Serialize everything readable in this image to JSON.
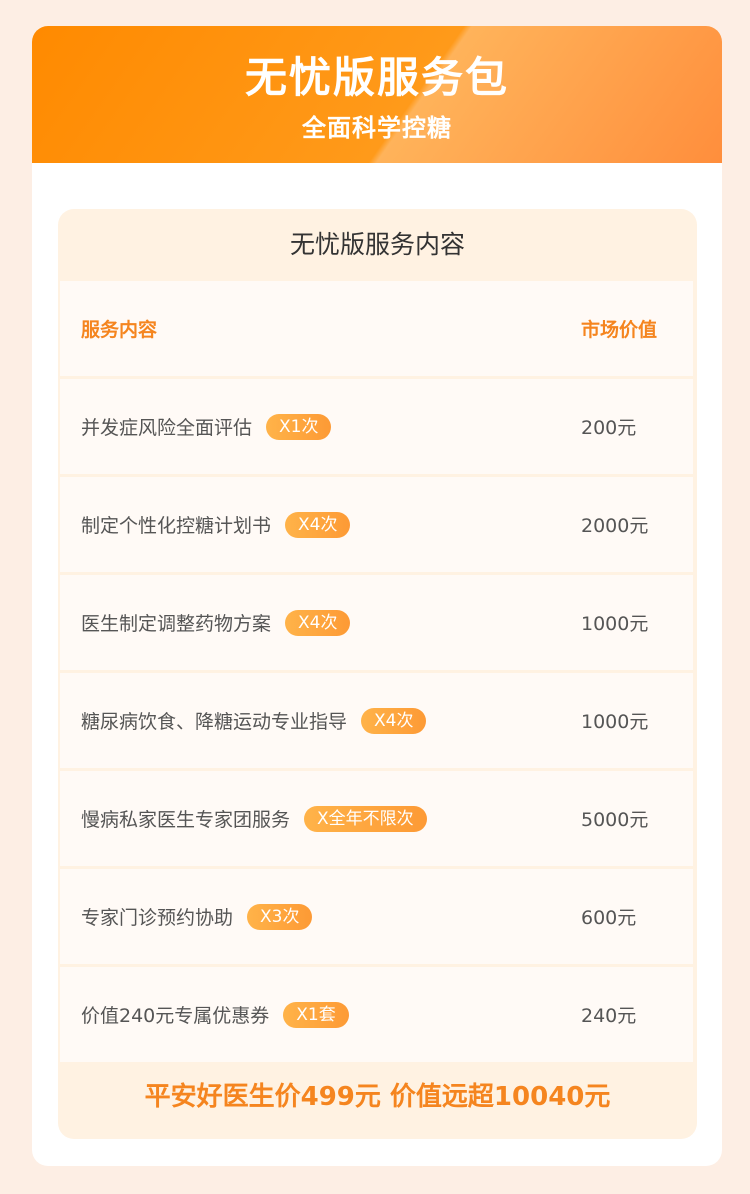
{
  "banner": {
    "title": "无忧版服务包",
    "subtitle": "全面科学控糖"
  },
  "table": {
    "title": "无忧版服务内容",
    "header": {
      "content": "服务内容",
      "value": "市场价值"
    },
    "rows": [
      {
        "name": "并发症风险全面评估",
        "badge": "X1次",
        "price": "200元"
      },
      {
        "name": "制定个性化控糖计划书",
        "badge": "X4次",
        "price": "2000元"
      },
      {
        "name": "医生制定调整药物方案",
        "badge": "X4次",
        "price": "1000元"
      },
      {
        "name": "糖尿病饮食、降糖运动专业指导",
        "badge": "X4次",
        "price": "1000元"
      },
      {
        "name": "慢病私家医生专家团服务",
        "badge": "X全年不限次",
        "price": "5000元"
      },
      {
        "name": "专家门诊预约协助",
        "badge": "X3次",
        "price": "600元"
      },
      {
        "name": "价值240元专属优惠券",
        "badge": "X1套",
        "price": "240元"
      }
    ],
    "footer": "平安好医生价499元 价值远超10040元"
  },
  "colors": {
    "accent": "#f5851f",
    "banner_start": "#ff8a00",
    "banner_end": "#ff8e3c",
    "page_background": "#fdeee4",
    "table_background": "#fff2e2",
    "row_background": "#fffaf6"
  }
}
